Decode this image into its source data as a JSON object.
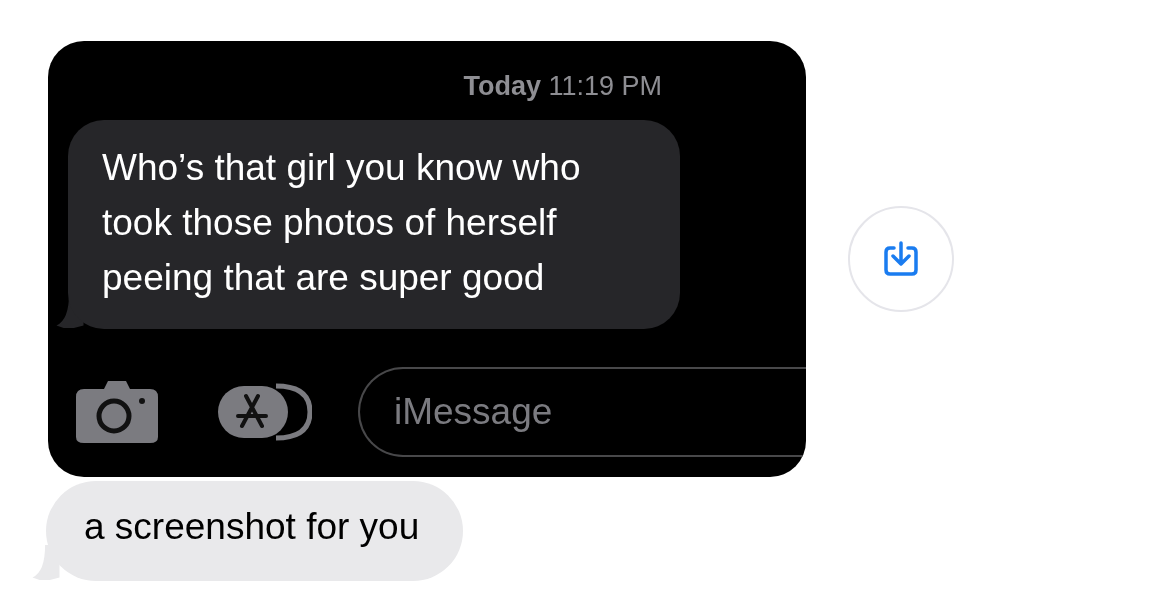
{
  "shared_screenshot": {
    "timestamp": "**Today** 11:19 PM",
    "message": {
      "text": "Who’s that girl you know who took those photos of herself peeing that are super good"
    },
    "input": {
      "placeholder": "iMessage"
    }
  },
  "message": {
    "text": "a screenshot for you"
  }
}
